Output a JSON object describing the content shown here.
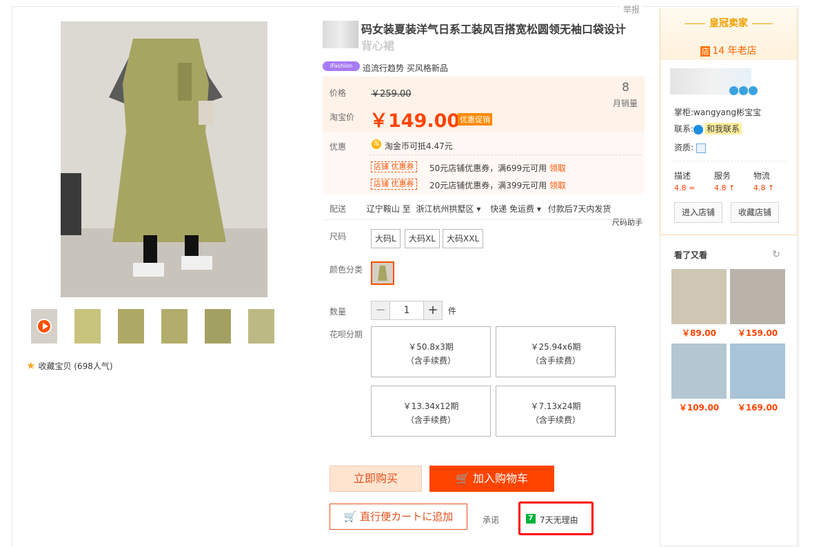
{
  "report": "举报",
  "title_visible": "码女装夏装洋气日系工装风百搭宽松圆领无袖口袋设计",
  "title_line2": "背心裙",
  "tag_badge": "iFashion",
  "subtitle": "追流行趋势 买风格新品",
  "price": {
    "label": "价格",
    "original": "￥259.00",
    "taobao_label": "淘宝价",
    "current": "￥149.00",
    "promo_badge": "优惠促销",
    "monthly_sales": "8",
    "monthly_sales_label": "月销量"
  },
  "discount": {
    "label": "优惠",
    "coin_icon": "淘",
    "coin_text": "淘金币可抵4.47元",
    "coupons": [
      {
        "tag": "店铺 优惠券",
        "text": "50元店铺优惠券，满699元可用",
        "link": "领取"
      },
      {
        "tag": "店铺 优惠券",
        "text": "20元店铺优惠券，满399元可用",
        "link": "领取"
      }
    ]
  },
  "delivery": {
    "label": "配送",
    "from": "辽宁鞍山 至",
    "to": "浙江杭州拱墅区",
    "method": "快递 免运费",
    "ship_time": "付款后7天内发货",
    "size_assistant": "尺码助手"
  },
  "size": {
    "label": "尺码",
    "options": [
      "大码L",
      "大码XL",
      "大码XXL"
    ]
  },
  "color": {
    "label": "颜色分类"
  },
  "quantity": {
    "label": "数量",
    "minus": "−",
    "value": "1",
    "plus": "+",
    "unit": "件"
  },
  "installment": {
    "label": "花呗分期",
    "plans": [
      {
        "amount": "￥50.8x3期",
        "note": "（含手续费）"
      },
      {
        "amount": "￥25.94x6期",
        "note": "（含手续费）"
      },
      {
        "amount": "￥13.34x12期",
        "note": "（含手续费）"
      },
      {
        "amount": "￥7.13x24期",
        "note": "（含手续费）"
      }
    ]
  },
  "buttons": {
    "buy_now": "立即购买",
    "add_cart": "加入购物车",
    "convenience": "直行便カートに追加"
  },
  "promise": {
    "label": "承诺",
    "icon": "7",
    "text": "7天无理由"
  },
  "favorite": {
    "text": "收藏宝贝 (698人气)"
  },
  "seller": {
    "badge": "皇冠卖家",
    "years_icon": "店",
    "years": "14 年老店",
    "keeper_label": "掌柜:",
    "keeper": "wangyang彬宝宝",
    "contact_label": "联系:",
    "contact_btn": "和我联系",
    "qualification_label": "资质:",
    "scores": [
      {
        "label": "描述",
        "value": "4.8",
        "trend": "="
      },
      {
        "label": "服务",
        "value": "4.8",
        "trend": "↑"
      },
      {
        "label": "物流",
        "value": "4.8",
        "trend": "↑"
      }
    ],
    "enter_shop": "进入店铺",
    "fav_shop": "收藏店铺"
  },
  "see_also": {
    "title": "看了又看",
    "items": [
      {
        "price": "￥89.00"
      },
      {
        "price": "￥159.00"
      },
      {
        "price": "￥109.00"
      },
      {
        "price": "￥169.00"
      }
    ]
  },
  "colors": {
    "accent": "#ff4400",
    "highlight_border": "#ff0000",
    "price_bg": "#fff2e8"
  }
}
